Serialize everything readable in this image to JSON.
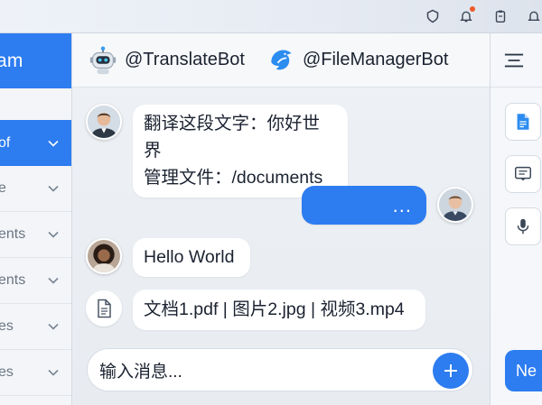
{
  "sidebar": {
    "title": "am",
    "items": [
      {
        "label": "of",
        "active": true
      },
      {
        "label": "e",
        "active": false
      },
      {
        "label": "ents",
        "active": false
      },
      {
        "label": "ents",
        "active": false
      },
      {
        "label": "es",
        "active": false
      },
      {
        "label": "es",
        "active": false
      }
    ]
  },
  "chat": {
    "bots": [
      {
        "name": "@TranslateBot",
        "icon": "robot-icon"
      },
      {
        "name": "@FileManagerBot",
        "icon": "file-manager-bird-icon"
      }
    ],
    "messages": [
      {
        "line1": "翻译这段文字：你好世界",
        "line2": "管理文件：/documents"
      },
      {
        "text": "..."
      },
      {
        "text": "Hello World"
      },
      {
        "text": "文档1.pdf | 图片2.jpg | 视频3.mp4"
      }
    ],
    "input": {
      "placeholder": "输入消息..."
    }
  },
  "right_panel": {
    "new_button_label": "Ne"
  },
  "colors": {
    "accent": "#2d7cf0",
    "notification_dot": "#ef5a2a"
  }
}
